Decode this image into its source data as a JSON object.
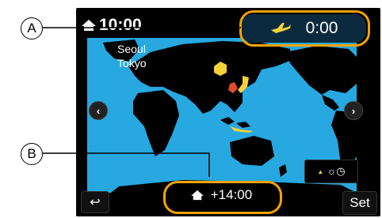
{
  "callouts": {
    "a": "A",
    "b": "B"
  },
  "home_time": "10:00",
  "destination": {
    "time": "0:00",
    "icon": "airplane-icon"
  },
  "cities": [
    "Seoul",
    "Tokyo"
  ],
  "offset": {
    "icon": "home-icon",
    "value": "+14:00"
  },
  "summer_time": {
    "icon": "summer-time-icon",
    "symbol": "☼◷"
  },
  "buttons": {
    "prev": "‹",
    "next": "›",
    "back": "↩",
    "set": "Set"
  },
  "colors": {
    "map_bg": "#27a8e0",
    "land": "#000000",
    "highlight": "#f5d23a",
    "callout_ring": "#f5a300"
  }
}
